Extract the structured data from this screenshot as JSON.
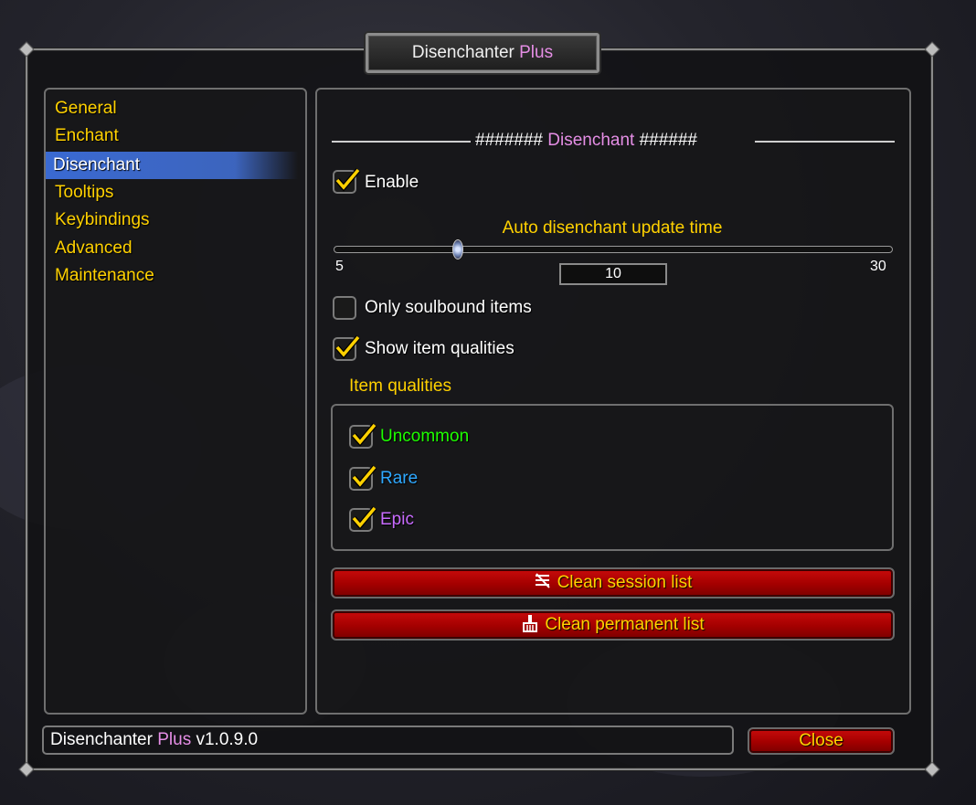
{
  "window": {
    "title_main": "Disenchanter",
    "title_accent": "Plus"
  },
  "sidebar": {
    "items": [
      {
        "label": "General"
      },
      {
        "label": "Enchant"
      },
      {
        "label": "Disenchant",
        "active": true
      },
      {
        "label": "Tooltips"
      },
      {
        "label": "Keybindings"
      },
      {
        "label": "Advanced"
      },
      {
        "label": "Maintenance"
      }
    ]
  },
  "section": {
    "header_prefix": "#######",
    "header_name": "Disenchant",
    "header_suffix": "######"
  },
  "options": {
    "enable": {
      "label": "Enable",
      "checked": true
    },
    "slider": {
      "title": "Auto disenchant update time",
      "min": "5",
      "max": "30",
      "value": "10"
    },
    "only_soulbound": {
      "label": "Only soulbound items",
      "checked": false
    },
    "show_qualities": {
      "label": "Show item qualities",
      "checked": true
    }
  },
  "qualities": {
    "title": "Item qualities",
    "items": [
      {
        "label": "Uncommon",
        "color": "#1eff00",
        "checked": true
      },
      {
        "label": "Rare",
        "color": "#2ea8ff",
        "checked": true
      },
      {
        "label": "Epic",
        "color": "#c86bff",
        "checked": true
      }
    ]
  },
  "buttons": {
    "clean_session": "Clean session list",
    "clean_permanent": "Clean permanent list",
    "close": "Close"
  },
  "status": {
    "name": "Disenchanter",
    "accent": "Plus",
    "version": "v1.0.9.0"
  },
  "colors": {
    "accent_pink": "#e58ee5",
    "gold": "#ffd100",
    "button_red": "#b00000"
  }
}
